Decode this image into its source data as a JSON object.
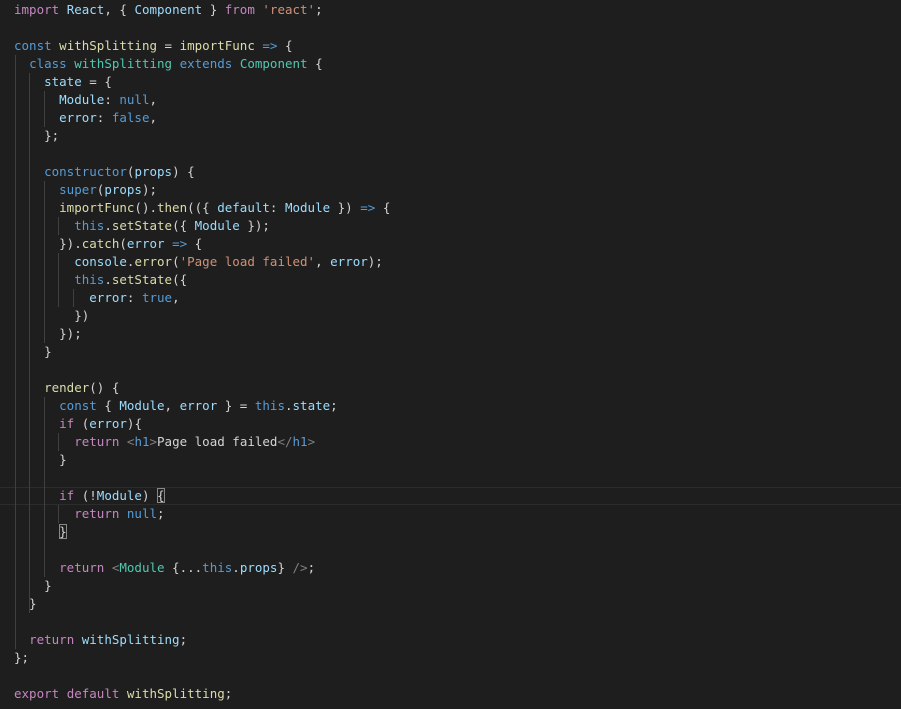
{
  "editor": {
    "language": "javascript",
    "colors": {
      "background": "#1e1e1e",
      "default": "#d4d4d4",
      "keyword": "#c586c0",
      "storage": "#569cd6",
      "variable": "#9cdcfe",
      "function": "#dcdcaa",
      "type": "#4ec9b0",
      "string": "#ce9178",
      "tag_bracket": "#808080",
      "indent_guide": "#404040"
    },
    "lines": [
      [
        [
          "import",
          "kw"
        ],
        [
          " ",
          ""
        ],
        [
          "React",
          "var"
        ],
        [
          ", { ",
          ""
        ],
        [
          "Component",
          "var"
        ],
        [
          " } ",
          ""
        ],
        [
          "from",
          "kw"
        ],
        [
          " ",
          ""
        ],
        [
          "'react'",
          "str"
        ],
        [
          ";",
          ""
        ]
      ],
      [],
      [
        [
          "const",
          "sto"
        ],
        [
          " ",
          ""
        ],
        [
          "withSplitting",
          "fn"
        ],
        [
          " = ",
          ""
        ],
        [
          "importFunc",
          "fn"
        ],
        [
          " ",
          ""
        ],
        [
          "=>",
          "sto"
        ],
        [
          " {",
          ""
        ]
      ],
      [
        [
          "  ",
          ""
        ],
        [
          "class",
          "sto"
        ],
        [
          " ",
          ""
        ],
        [
          "withSplitting",
          "type"
        ],
        [
          " ",
          ""
        ],
        [
          "extends",
          "sto"
        ],
        [
          " ",
          ""
        ],
        [
          "Component",
          "type"
        ],
        [
          " {",
          ""
        ]
      ],
      [
        [
          "    ",
          ""
        ],
        [
          "state",
          "var"
        ],
        [
          " = {",
          ""
        ]
      ],
      [
        [
          "      ",
          ""
        ],
        [
          "Module",
          "var"
        ],
        [
          ": ",
          ""
        ],
        [
          "null",
          "sto"
        ],
        [
          ",",
          ""
        ]
      ],
      [
        [
          "      ",
          ""
        ],
        [
          "error",
          "var"
        ],
        [
          ": ",
          ""
        ],
        [
          "false",
          "sto"
        ],
        [
          ",",
          ""
        ]
      ],
      [
        [
          "    };",
          ""
        ]
      ],
      [],
      [
        [
          "    ",
          ""
        ],
        [
          "constructor",
          "sto"
        ],
        [
          "(",
          ""
        ],
        [
          "props",
          "var"
        ],
        [
          ") {",
          ""
        ]
      ],
      [
        [
          "      ",
          ""
        ],
        [
          "super",
          "sto"
        ],
        [
          "(",
          ""
        ],
        [
          "props",
          "var"
        ],
        [
          ");",
          ""
        ]
      ],
      [
        [
          "      ",
          ""
        ],
        [
          "importFunc",
          "fn"
        ],
        [
          "().",
          ""
        ],
        [
          "then",
          "fn"
        ],
        [
          "(({ ",
          ""
        ],
        [
          "default",
          "var"
        ],
        [
          ": ",
          ""
        ],
        [
          "Module",
          "var"
        ],
        [
          " }) ",
          ""
        ],
        [
          "=>",
          "sto"
        ],
        [
          " {",
          ""
        ]
      ],
      [
        [
          "        ",
          ""
        ],
        [
          "this",
          "sto"
        ],
        [
          ".",
          ""
        ],
        [
          "setState",
          "fn"
        ],
        [
          "({ ",
          ""
        ],
        [
          "Module",
          "var"
        ],
        [
          " });",
          ""
        ]
      ],
      [
        [
          "      }).",
          ""
        ],
        [
          "catch",
          "fn"
        ],
        [
          "(",
          ""
        ],
        [
          "error",
          "var"
        ],
        [
          " ",
          ""
        ],
        [
          "=>",
          "sto"
        ],
        [
          " {",
          ""
        ]
      ],
      [
        [
          "        ",
          ""
        ],
        [
          "console",
          "var"
        ],
        [
          ".",
          ""
        ],
        [
          "error",
          "fn"
        ],
        [
          "(",
          ""
        ],
        [
          "'Page load failed'",
          "str"
        ],
        [
          ", ",
          ""
        ],
        [
          "error",
          "var"
        ],
        [
          ");",
          ""
        ]
      ],
      [
        [
          "        ",
          ""
        ],
        [
          "this",
          "sto"
        ],
        [
          ".",
          ""
        ],
        [
          "setState",
          "fn"
        ],
        [
          "({",
          ""
        ]
      ],
      [
        [
          "          ",
          ""
        ],
        [
          "error",
          "var"
        ],
        [
          ": ",
          ""
        ],
        [
          "true",
          "sto"
        ],
        [
          ",",
          ""
        ]
      ],
      [
        [
          "        })",
          ""
        ]
      ],
      [
        [
          "      });",
          ""
        ]
      ],
      [
        [
          "    }",
          ""
        ]
      ],
      [],
      [
        [
          "    ",
          ""
        ],
        [
          "render",
          "fn"
        ],
        [
          "() {",
          ""
        ]
      ],
      [
        [
          "      ",
          ""
        ],
        [
          "const",
          "sto"
        ],
        [
          " { ",
          ""
        ],
        [
          "Module",
          "var"
        ],
        [
          ", ",
          ""
        ],
        [
          "error",
          "var"
        ],
        [
          " } = ",
          ""
        ],
        [
          "this",
          "sto"
        ],
        [
          ".",
          ""
        ],
        [
          "state",
          "var"
        ],
        [
          ";",
          ""
        ]
      ],
      [
        [
          "      ",
          ""
        ],
        [
          "if",
          "kw"
        ],
        [
          " (",
          ""
        ],
        [
          "error",
          "var"
        ],
        [
          "){",
          ""
        ]
      ],
      [
        [
          "        ",
          ""
        ],
        [
          "return",
          "kw"
        ],
        [
          " ",
          ""
        ],
        [
          "<",
          "tag"
        ],
        [
          "h1",
          "sto"
        ],
        [
          ">",
          "tag"
        ],
        [
          "Page load failed",
          ""
        ],
        [
          "</",
          "tag"
        ],
        [
          "h1",
          "sto"
        ],
        [
          ">",
          "tag"
        ]
      ],
      [
        [
          "      }",
          ""
        ]
      ],
      [],
      [
        [
          "      ",
          ""
        ],
        [
          "if",
          "kw"
        ],
        [
          " (!",
          ""
        ],
        [
          "Module",
          "var"
        ],
        [
          ") ",
          ""
        ],
        [
          "{",
          "bm"
        ]
      ],
      [
        [
          "        ",
          ""
        ],
        [
          "return",
          "kw"
        ],
        [
          " ",
          ""
        ],
        [
          "null",
          "sto"
        ],
        [
          ";",
          ""
        ]
      ],
      [
        [
          "      ",
          ""
        ],
        [
          "}",
          "bm"
        ]
      ],
      [],
      [
        [
          "      ",
          ""
        ],
        [
          "return",
          "kw"
        ],
        [
          " ",
          ""
        ],
        [
          "<",
          "tag"
        ],
        [
          "Module",
          "type"
        ],
        [
          " {...",
          ""
        ],
        [
          "this",
          "sto"
        ],
        [
          ".",
          ""
        ],
        [
          "props",
          "var"
        ],
        [
          "} ",
          ""
        ],
        [
          "/>",
          "tag"
        ],
        [
          ";",
          ""
        ]
      ],
      [
        [
          "    }",
          ""
        ]
      ],
      [
        [
          "  }",
          ""
        ]
      ],
      [],
      [
        [
          "  ",
          ""
        ],
        [
          "return",
          "kw"
        ],
        [
          " ",
          ""
        ],
        [
          "withSplitting",
          "var"
        ],
        [
          ";",
          ""
        ]
      ],
      [
        [
          "};",
          ""
        ]
      ],
      [],
      [
        [
          "export",
          "kw"
        ],
        [
          " ",
          ""
        ],
        [
          "default",
          "kw"
        ],
        [
          " ",
          ""
        ],
        [
          "withSplitting",
          "fn"
        ],
        [
          ";",
          ""
        ]
      ]
    ]
  }
}
